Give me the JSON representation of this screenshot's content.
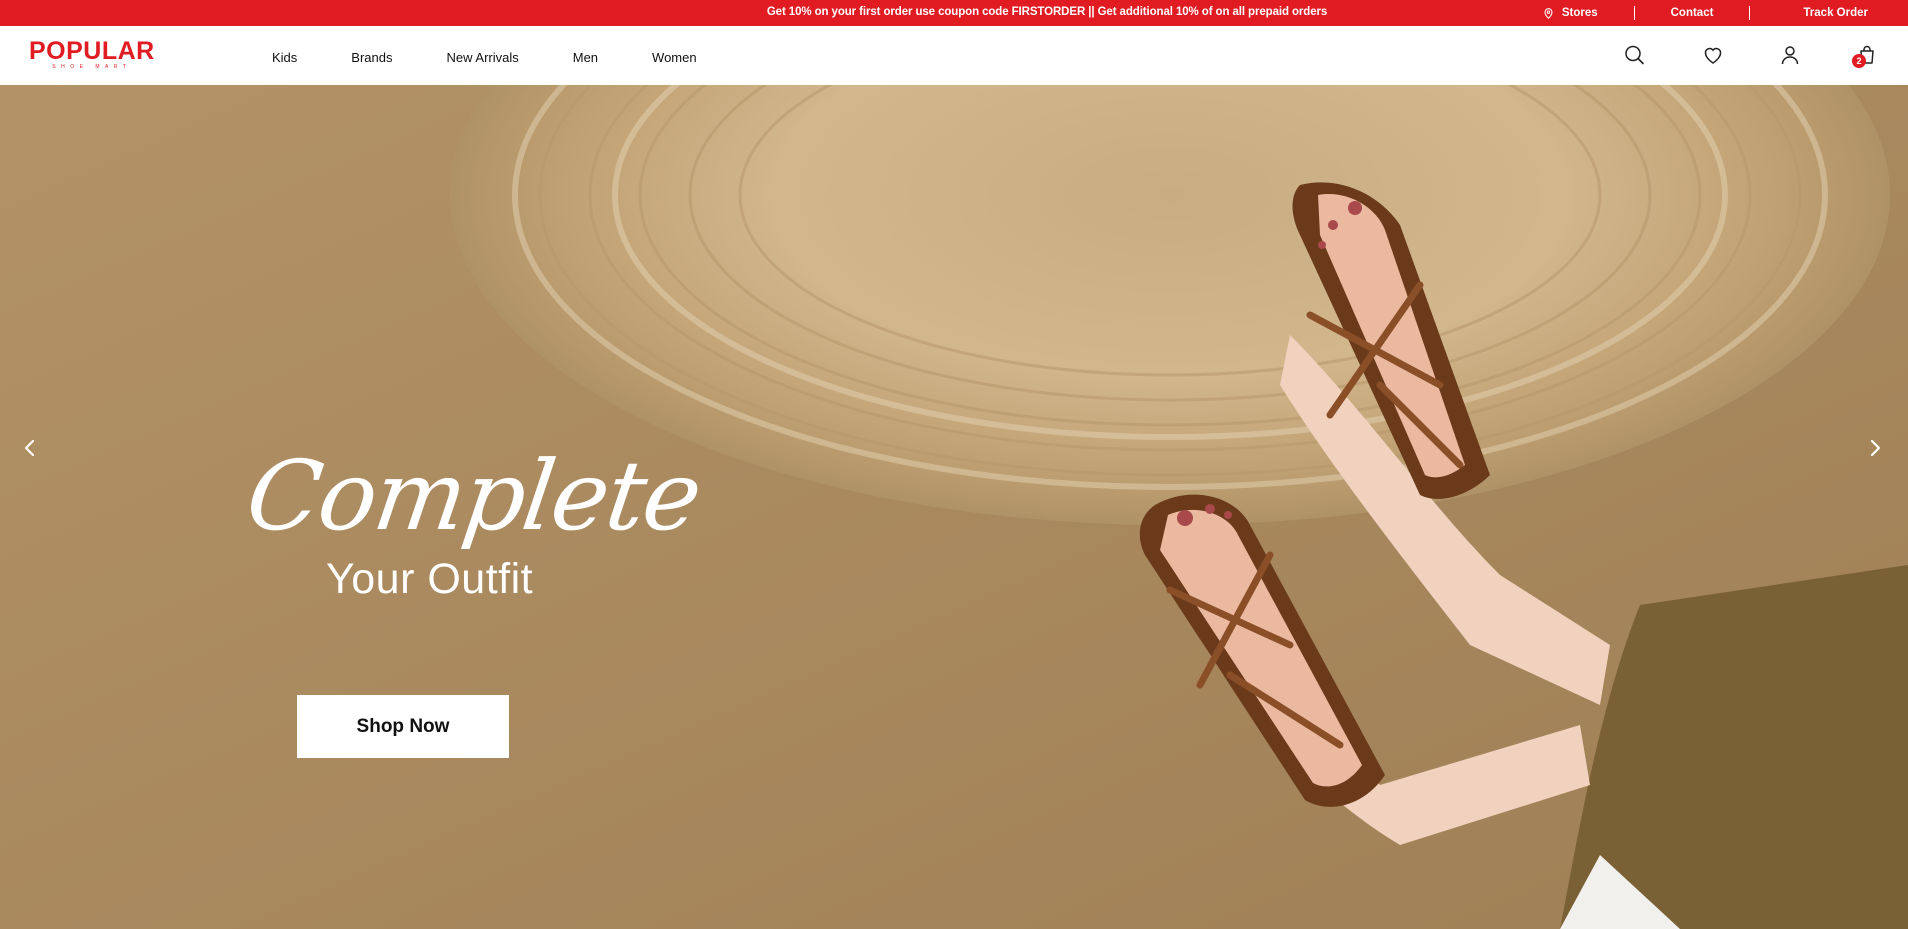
{
  "topbar": {
    "promo_text": "Get 10% on your first order use coupon code FIRSTORDER || Get additional 10% of on all prepaid orders",
    "links": [
      "Stores",
      "Contact",
      "Track Order"
    ]
  },
  "header": {
    "logo": "POPULAR",
    "logo_sub": "SHOE MART",
    "nav": [
      "Kids",
      "Brands",
      "New Arrivals",
      "Men",
      "Women"
    ],
    "cart_count": "2",
    "icons": [
      "search-icon",
      "heart-icon",
      "user-icon",
      "cart-icon"
    ]
  },
  "hero": {
    "script_text": "Complete",
    "title": "Your Outfit",
    "cta_label": "Shop Now"
  },
  "colors": {
    "brand": "#e01b22",
    "hero_bg": "#a9895f"
  }
}
